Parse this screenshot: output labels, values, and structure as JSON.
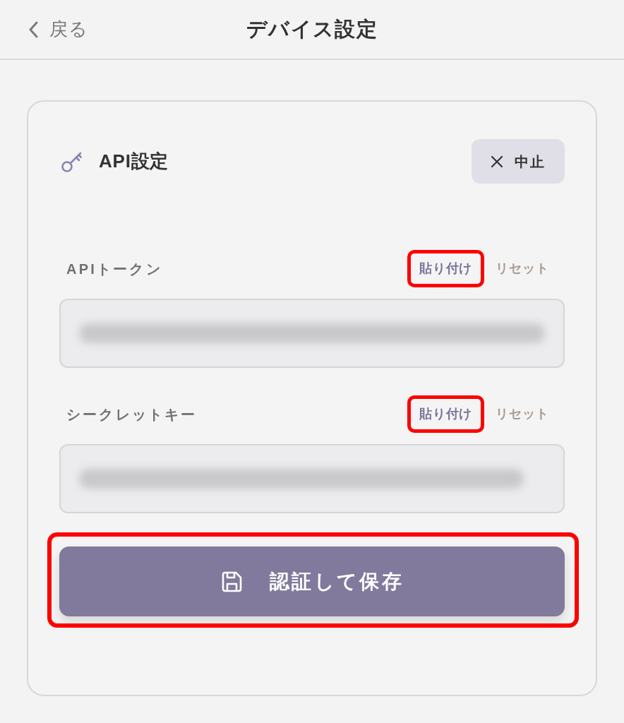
{
  "header": {
    "back": {
      "label": "戻る"
    },
    "title": "デバイス設定"
  },
  "card": {
    "title": "API設定",
    "cancel_button": {
      "label": "中止"
    },
    "fields": [
      {
        "label": "APIトークン",
        "paste": {
          "label": "貼り付け",
          "highlighted": true
        },
        "reset": {
          "label": "リセット"
        },
        "value_blurred": true
      },
      {
        "label": "シークレットキー",
        "paste": {
          "label": "貼り付け",
          "highlighted": true
        },
        "reset": {
          "label": "リセット"
        },
        "value_blurred": true
      }
    ],
    "submit": {
      "label": "認証して保存",
      "highlighted": true
    }
  }
}
